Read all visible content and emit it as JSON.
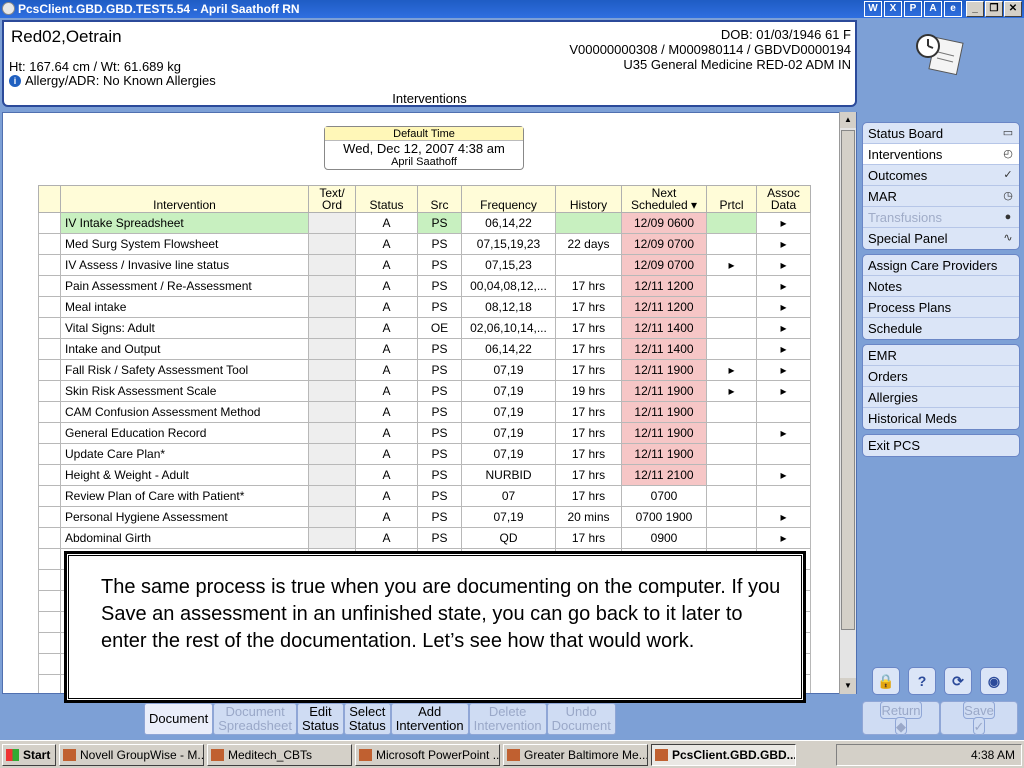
{
  "window": {
    "title": "PcsClient.GBD.GBD.TEST5.54 - April Saathoff RN"
  },
  "patient": {
    "name": "Red02,Oetrain",
    "ht_wt": "Ht: 167.64 cm / Wt: 61.689 kg",
    "allergy": "Allergy/ADR: No Known Allergies",
    "dob": "DOB: 01/03/1946 61 F",
    "ids": "V00000000308 / M000980114 / GBDVD0000194",
    "location": "U35 General Medicine  RED-02  ADM IN",
    "screen_title": "Interventions"
  },
  "default_time": {
    "label": "Default Time",
    "datetime": "Wed, Dec 12, 2007  4:38 am",
    "user": "April Saathoff"
  },
  "grid": {
    "columns": [
      "Intervention",
      "Text/ Ord",
      "Status",
      "Src",
      "Frequency",
      "History",
      "Next Scheduled",
      "Prtcl",
      "Assoc Data"
    ],
    "rows": [
      {
        "name": "IV Intake Spreadsheet",
        "text": "",
        "status": "A",
        "src": "PS",
        "freq": "06,14,22",
        "history": "",
        "next": "12/09 0600",
        "prtcl": "",
        "assoc": "▸",
        "overdue": true
      },
      {
        "name": "Med Surg System Flowsheet",
        "text": "",
        "status": "A",
        "src": "PS",
        "freq": "07,15,19,23",
        "history": "22 days",
        "next": "12/09 0700",
        "prtcl": "",
        "assoc": "▸",
        "overdue": true
      },
      {
        "name": "IV Assess / Invasive line status",
        "text": "",
        "status": "A",
        "src": "PS",
        "freq": "07,15,23",
        "history": "",
        "next": "12/09 0700",
        "prtcl": "▸",
        "assoc": "▸",
        "overdue": true
      },
      {
        "name": "Pain Assessment / Re-Assessment",
        "text": "",
        "status": "A",
        "src": "PS",
        "freq": "00,04,08,12,...",
        "history": "17 hrs",
        "next": "12/11 1200",
        "prtcl": "",
        "assoc": "▸",
        "overdue": true
      },
      {
        "name": "Meal intake",
        "text": "",
        "status": "A",
        "src": "PS",
        "freq": "08,12,18",
        "history": "17 hrs",
        "next": "12/11 1200",
        "prtcl": "",
        "assoc": "▸",
        "overdue": true
      },
      {
        "name": "Vital Signs: Adult",
        "text": "",
        "status": "A",
        "src": "OE",
        "freq": "02,06,10,14,...",
        "history": "17 hrs",
        "next": "12/11 1400",
        "prtcl": "",
        "assoc": "▸",
        "overdue": true
      },
      {
        "name": "Intake and Output",
        "text": "",
        "status": "A",
        "src": "PS",
        "freq": "06,14,22",
        "history": "17 hrs",
        "next": "12/11 1400",
        "prtcl": "",
        "assoc": "▸",
        "overdue": true
      },
      {
        "name": "Fall Risk / Safety Assessment Tool",
        "text": "",
        "status": "A",
        "src": "PS",
        "freq": "07,19",
        "history": "17 hrs",
        "next": "12/11 1900",
        "prtcl": "▸",
        "assoc": "▸",
        "overdue": true
      },
      {
        "name": "Skin Risk Assessment Scale",
        "text": "",
        "status": "A",
        "src": "PS",
        "freq": "07,19",
        "history": "19 hrs",
        "next": "12/11 1900",
        "prtcl": "▸",
        "assoc": "▸",
        "overdue": true
      },
      {
        "name": "CAM Confusion Assessment Method",
        "text": "",
        "status": "A",
        "src": "PS",
        "freq": "07,19",
        "history": "17 hrs",
        "next": "12/11 1900",
        "prtcl": "",
        "assoc": "",
        "overdue": true
      },
      {
        "name": "General Education Record",
        "text": "",
        "status": "A",
        "src": "PS",
        "freq": "07,19",
        "history": "17 hrs",
        "next": "12/11 1900",
        "prtcl": "",
        "assoc": "▸",
        "overdue": true
      },
      {
        "name": "Update Care Plan*",
        "text": "",
        "status": "A",
        "src": "PS",
        "freq": "07,19",
        "history": "17 hrs",
        "next": "12/11 1900",
        "prtcl": "",
        "assoc": "",
        "overdue": true
      },
      {
        "name": "Height & Weight - Adult",
        "text": "",
        "status": "A",
        "src": "PS",
        "freq": "NURBID",
        "history": "17 hrs",
        "next": "12/11 2100",
        "prtcl": "",
        "assoc": "▸",
        "overdue": true
      },
      {
        "name": "Review Plan of Care with Patient*",
        "text": "",
        "status": "A",
        "src": "PS",
        "freq": "07",
        "history": "17 hrs",
        "next": "0700",
        "prtcl": "",
        "assoc": "",
        "overdue": false
      },
      {
        "name": "Personal Hygiene Assessment",
        "text": "",
        "status": "A",
        "src": "PS",
        "freq": "07,19",
        "history": "20 mins",
        "next": "0700 1900",
        "prtcl": "",
        "assoc": "▸",
        "overdue": false
      },
      {
        "name": "Abdominal Girth",
        "text": "",
        "status": "A",
        "src": "PS",
        "freq": "QD",
        "history": "17 hrs",
        "next": "0900",
        "prtcl": "",
        "assoc": "▸",
        "overdue": false
      }
    ]
  },
  "callout": {
    "text": "The same process is true when you are documenting on the computer. If you Save an assessment in an unfinished state, you can go back to it later to enter the rest of the documentation. Let’s see how that would work."
  },
  "toolbar": {
    "buttons": [
      {
        "l1": "Document",
        "l2": "",
        "state": "active"
      },
      {
        "l1": "Document",
        "l2": "Spreadsheet",
        "state": "disabled"
      },
      {
        "l1": "Edit",
        "l2": "Status",
        "state": "normal"
      },
      {
        "l1": "Select",
        "l2": "Status",
        "state": "normal"
      },
      {
        "l1": "Add",
        "l2": "Intervention",
        "state": "normal"
      },
      {
        "l1": "Delete",
        "l2": "Intervention",
        "state": "disabled"
      },
      {
        "l1": "Undo",
        "l2": "Document",
        "state": "disabled"
      }
    ]
  },
  "nav": {
    "group1": [
      {
        "label": "Status Board",
        "icon": "book-icon",
        "glyph": "▭",
        "state": "normal"
      },
      {
        "label": "Interventions",
        "icon": "clipboard-clock-icon",
        "glyph": "◴",
        "state": "active"
      },
      {
        "label": "Outcomes",
        "icon": "clipboard-check-icon",
        "glyph": "✓",
        "state": "normal"
      },
      {
        "label": "MAR",
        "icon": "medication-icon",
        "glyph": "◷",
        "state": "normal"
      },
      {
        "label": "Transfusions",
        "icon": "blood-drop-icon",
        "glyph": "●",
        "state": "disabled"
      },
      {
        "label": "Special Panel",
        "icon": "waveform-icon",
        "glyph": "∿",
        "state": "normal"
      }
    ],
    "group2": [
      "Assign Care Providers",
      "Notes",
      "Process Plans",
      "Schedule"
    ],
    "group3": [
      "EMR",
      "Orders",
      "Allergies",
      "Historical Meds"
    ],
    "group4": [
      "Exit PCS"
    ]
  },
  "bottom_right": {
    "return_label": "Return",
    "save_label": "Save"
  },
  "taskbar": {
    "start": "Start",
    "tasks": [
      {
        "label": "Novell GroupWise - M...",
        "active": false
      },
      {
        "label": "Meditech_CBTs",
        "active": false
      },
      {
        "label": "Microsoft PowerPoint ...",
        "active": false
      },
      {
        "label": "Greater Baltimore Me...",
        "active": false
      },
      {
        "label": "PcsClient.GBD.GBD....",
        "active": true
      }
    ],
    "clock": "4:38 AM"
  }
}
